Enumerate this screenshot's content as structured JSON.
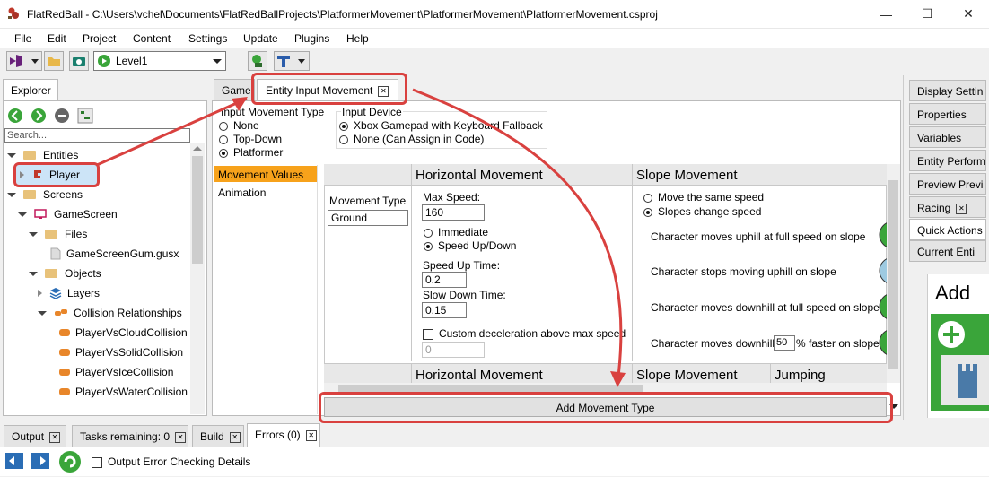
{
  "window": {
    "title": "FlatRedBall - C:\\Users\\vchel\\Documents\\FlatRedBallProjects\\PlatformerMovement\\PlatformerMovement\\PlatformerMovement.csproj",
    "minimize": "—",
    "maximize": "☐",
    "close": "✕"
  },
  "menu": [
    "File",
    "Edit",
    "Project",
    "Content",
    "Settings",
    "Update",
    "Plugins",
    "Help"
  ],
  "toolbar": {
    "screen_combo_value": "Level1"
  },
  "explorer": {
    "tab_label": "Explorer",
    "search_placeholder": "Search...",
    "tree": {
      "entities": "Entities",
      "player": "Player",
      "screens": "Screens",
      "gamescreen": "GameScreen",
      "files": "Files",
      "gum_file": "GameScreenGum.gusx",
      "objects": "Objects",
      "layers": "Layers",
      "collision_relationships": "Collision Relationships",
      "relationships": [
        "PlayerVsCloudCollision",
        "PlayerVsSolidCollision",
        "PlayerVsIceCollision",
        "PlayerVsWaterCollision"
      ]
    }
  },
  "center": {
    "tabs": {
      "game": "Game",
      "entity_input": "Entity Input Movement"
    },
    "input_movement_type": {
      "label": "Input Movement Type",
      "options": [
        "None",
        "Top-Down",
        "Platformer"
      ],
      "selected": "Platformer"
    },
    "input_device": {
      "label": "Input Device",
      "options": [
        "Xbox Gamepad with Keyboard Fallback",
        "None (Can Assign in Code)"
      ],
      "selected": "Xbox Gamepad with Keyboard Fallback"
    },
    "side_list": [
      "Movement Values",
      "Animation"
    ],
    "movement_type": {
      "label": "Movement Type",
      "value": "Ground"
    },
    "horizontal": {
      "header": "Horizontal Movement",
      "max_speed_label": "Max Speed:",
      "max_speed": "160",
      "immediate": "Immediate",
      "speed_up_down": "Speed Up/Down",
      "speed_up_label": "Speed Up Time:",
      "speed_up": "0.2",
      "slow_down_label": "Slow Down Time:",
      "slow_down": "0.15",
      "custom_decel": "Custom deceleration above max speed",
      "custom_decel_value": "0"
    },
    "slope": {
      "header": "Slope Movement",
      "move_same": "Move the same speed",
      "slopes_change": "Slopes change speed",
      "uphill_full": "Character moves uphill at full speed on slope",
      "stops_uphill": "Character stops moving uphill on slope",
      "downhill_full": "Character moves downhill at full speed on slope",
      "downhill_pre": "Character moves downhill",
      "downhill_value": "50",
      "downhill_post": "% faster on slope"
    },
    "second_row": {
      "horizontal": "Horizontal Movement",
      "slope": "Slope Movement",
      "jumping": "Jumping"
    },
    "add_button": "Add Movement Type"
  },
  "right_panel": {
    "buttons": [
      "Display Settin",
      "Properties",
      "Variables",
      "Entity Perform",
      "Preview Previ",
      "Racing"
    ],
    "tabs": [
      "Quick Actions",
      "Current Enti"
    ],
    "add_label": "Add"
  },
  "bottom": {
    "tabs": [
      "Output",
      "Tasks remaining: 0",
      "Build",
      "Errors (0)"
    ],
    "output_checkbox": "Output Error Checking Details"
  },
  "colors": {
    "highlight_red": "#d9413f",
    "selected_orange": "#f7a21b",
    "selection_blue": "#cce4f7",
    "vs_purple": "#68217a",
    "green_button": "#3aa53a"
  }
}
